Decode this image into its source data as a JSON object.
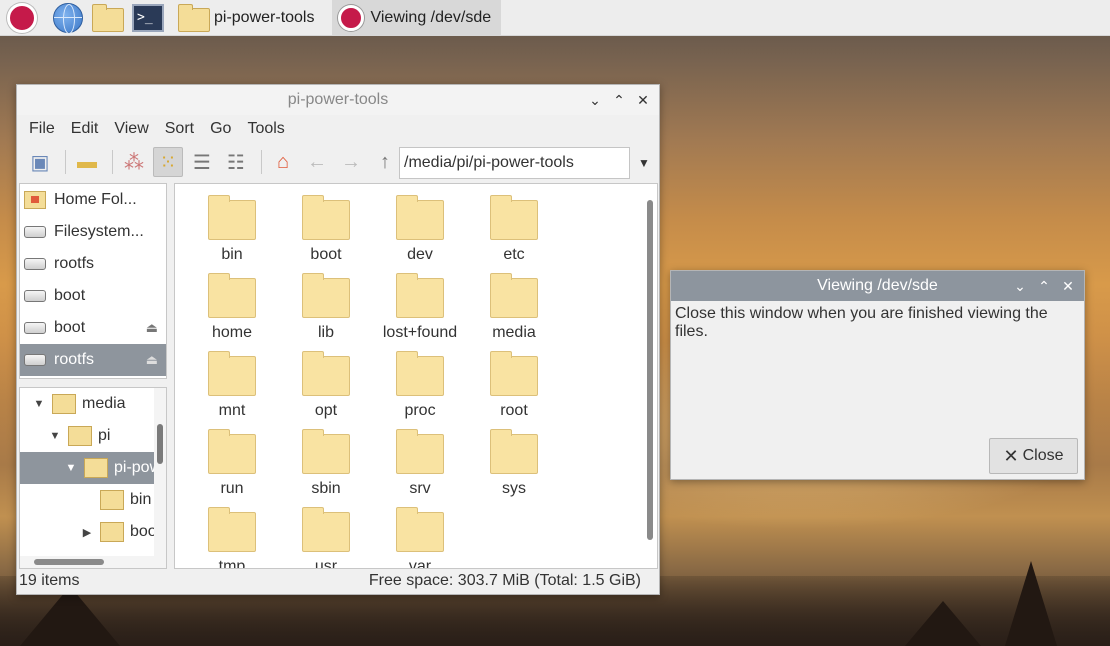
{
  "taskbar": {
    "launchers": [
      "raspberry-menu",
      "web-browser",
      "file-manager",
      "terminal"
    ],
    "tasks": [
      {
        "label": "pi-power-tools",
        "active": false
      },
      {
        "label": "Viewing /dev/sde",
        "active": true
      }
    ]
  },
  "filemanager": {
    "title": "pi-power-tools",
    "menu": [
      "File",
      "Edit",
      "View",
      "Sort",
      "Go",
      "Tools"
    ],
    "path": "/media/pi/pi-power-tools",
    "places": [
      {
        "label": "Home Fol...",
        "icon": "home-folder-icon",
        "eject": false
      },
      {
        "label": "Filesystem...",
        "icon": "drive-icon",
        "eject": false
      },
      {
        "label": "rootfs",
        "icon": "drive-icon",
        "eject": false
      },
      {
        "label": "boot",
        "icon": "drive-icon",
        "eject": false
      },
      {
        "label": "boot",
        "icon": "drive-icon",
        "eject": true
      },
      {
        "label": "rootfs",
        "icon": "drive-icon",
        "eject": true
      }
    ],
    "tree": [
      {
        "label": "media",
        "arrow": "▼"
      },
      {
        "label": "pi",
        "arrow": "▼"
      },
      {
        "label": "pi-pow",
        "arrow": "▼"
      },
      {
        "label": "bin",
        "arrow": ""
      },
      {
        "label": "boot",
        "arrow": "▶"
      }
    ],
    "folders": [
      "bin",
      "boot",
      "dev",
      "etc",
      "home",
      "lib",
      "lost+found",
      "media",
      "mnt",
      "opt",
      "proc",
      "root",
      "run",
      "sbin",
      "srv",
      "sys",
      "tmp",
      "usr",
      "var"
    ],
    "status_count": "19 items",
    "status_space": "Free space: 303.7 MiB (Total: 1.5 GiB)"
  },
  "dialog": {
    "title": "Viewing /dev/sde",
    "message": "Close this window when you are finished viewing the files.",
    "close_label": "Close"
  }
}
